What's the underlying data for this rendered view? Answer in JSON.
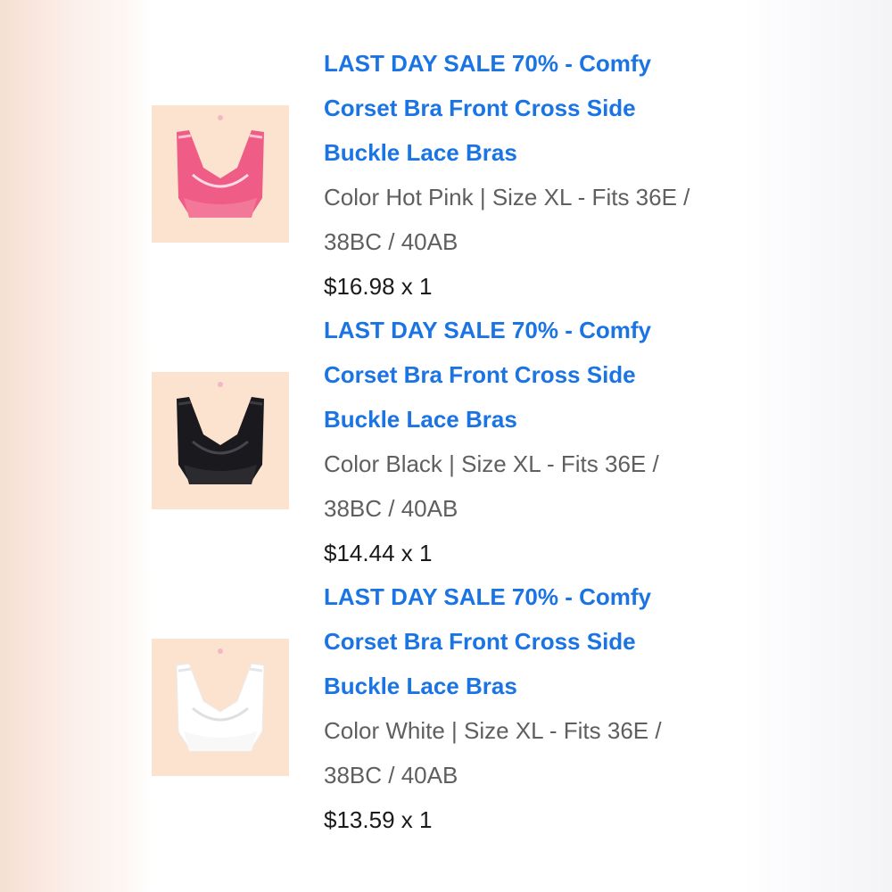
{
  "order_items": [
    {
      "title": "LAST DAY SALE 70% - Comfy Corset Bra Front Cross Side Buckle Lace Bras",
      "variant": "Color Hot Pink | Size XL - Fits 36E / 38BC / 40AB",
      "price": "$16.98 x 1",
      "image_icon": "pink-bra-thumbnail",
      "product_color": "#ef5c85"
    },
    {
      "title": "LAST DAY SALE 70% - Comfy Corset Bra Front Cross Side Buckle Lace Bras",
      "variant": "Color Black | Size XL - Fits 36E / 38BC / 40AB",
      "price": "$14.44 x 1",
      "image_icon": "black-bra-thumbnail",
      "product_color": "#1a1a1e"
    },
    {
      "title": "LAST DAY SALE 70% - Comfy Corset Bra Front Cross Side Buckle Lace Bras",
      "variant": "Color White | Size XL - Fits 36E / 38BC / 40AB",
      "price": "$13.59 x 1",
      "image_icon": "white-bra-thumbnail",
      "product_color": "#ffffff"
    }
  ],
  "colors": {
    "title_link": "#1b74e4",
    "variant_text": "#5f5f5f",
    "price_text": "#1a1a1a",
    "thumbnail_background": "#fbe3cf"
  }
}
